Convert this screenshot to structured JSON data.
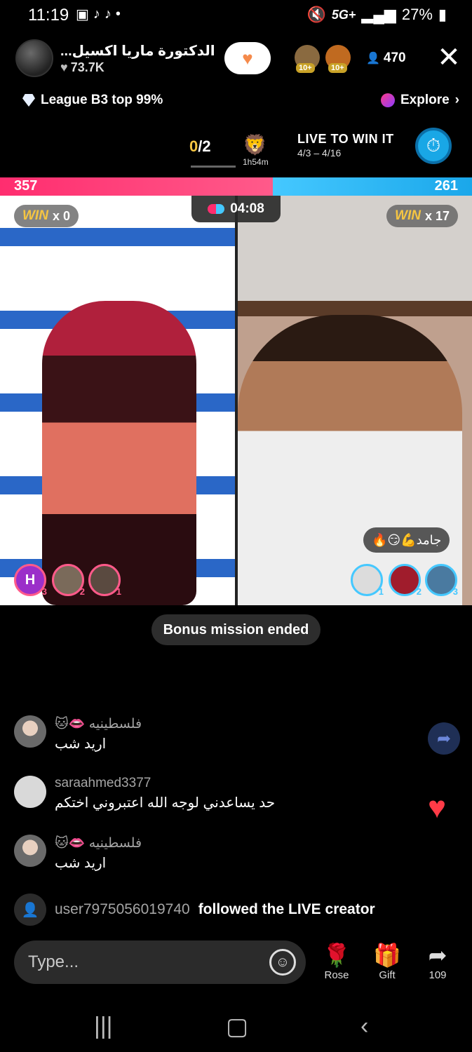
{
  "status": {
    "time": "11:19",
    "network": "5G+",
    "battery": "27%"
  },
  "header": {
    "host_name": "الدكتورة ماريا اكسيل...",
    "host_likes": "73.7K",
    "viewer_badges": [
      "10+",
      "10+"
    ],
    "viewer_count": "470",
    "close_icon": "close-icon"
  },
  "league": {
    "label": "League B3 top 99%",
    "explore": "Explore"
  },
  "mission": {
    "progress_done": "0",
    "progress_total": "/2",
    "time_left": "1h54m",
    "title": "LIVE TO WIN IT",
    "dates": "4/3 – 4/16"
  },
  "battle": {
    "score_left": "357",
    "score_right": "261",
    "left_share": 0.578,
    "timer": "04:08",
    "win_left_label": "WIN",
    "win_left_count": "x 0",
    "win_right_label": "WIN",
    "win_right_count": "x 17",
    "right_comment": "جامد💪😏🔥",
    "gifters_left": [
      {
        "initial": "H",
        "rank": "3",
        "color": "#9b2fc9"
      },
      {
        "initial": "",
        "rank": "2",
        "color": "#7a6a5a"
      },
      {
        "initial": "",
        "rank": "1",
        "color": "#5a4a40"
      }
    ],
    "gifters_right": [
      {
        "initial": "",
        "rank": "1",
        "color": "#dcdcdc"
      },
      {
        "initial": "",
        "rank": "2",
        "color": "#a01c2c"
      },
      {
        "initial": "",
        "rank": "3",
        "color": "#4a7aa0"
      }
    ],
    "colors": {
      "left": "#ff2d6f",
      "right": "#45c8ff"
    }
  },
  "toast": "Bonus mission ended",
  "chat": [
    {
      "user": "فلسطينيه",
      "badges": "🐱👄",
      "message": "اريد شب",
      "rtl_user": true
    },
    {
      "user": "saraahmed3377",
      "badges": "",
      "message": "حد يساعدني لوجه الله اعتبروني اختكم",
      "rtl_user": false
    },
    {
      "user": "فلسطينيه",
      "badges": "🐱👄",
      "message": "اريد شب",
      "rtl_user": true
    }
  ],
  "follow_event": {
    "user": "user7975056019740",
    "text": "followed the LIVE creator"
  },
  "bottom": {
    "input_placeholder": "Type...",
    "rose_label": "Rose",
    "gift_label": "Gift",
    "share_count": "109"
  }
}
